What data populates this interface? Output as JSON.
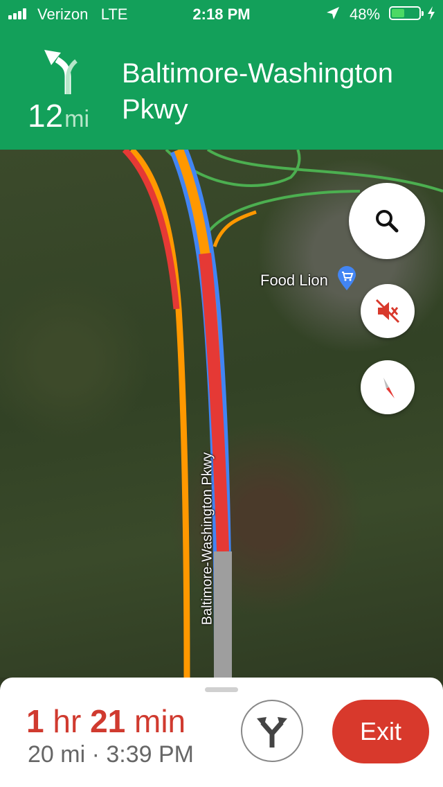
{
  "status_bar": {
    "carrier": "Verizon",
    "network": "LTE",
    "time": "2:18 PM",
    "battery_pct": "48%",
    "battery_level": 0.48
  },
  "navigation": {
    "distance_value": "12",
    "distance_unit": "mi",
    "street": "Baltimore-Washington Pkwy",
    "turn_icon": "slight-left-arrow-icon"
  },
  "map": {
    "poi_label": "Food Lion",
    "road_label": "Baltimore-Washington Pkwy"
  },
  "trip": {
    "eta_hours": "1",
    "eta_hours_unit": "hr",
    "eta_minutes": "21",
    "eta_minutes_unit": "min",
    "distance": "20 mi",
    "separator": "·",
    "arrival": "3:39 PM"
  },
  "buttons": {
    "exit": "Exit"
  },
  "colors": {
    "header_green": "#13a05a",
    "exit_red": "#d8392c",
    "eta_red": "#d03a2f",
    "route_blue": "#4285f4"
  }
}
